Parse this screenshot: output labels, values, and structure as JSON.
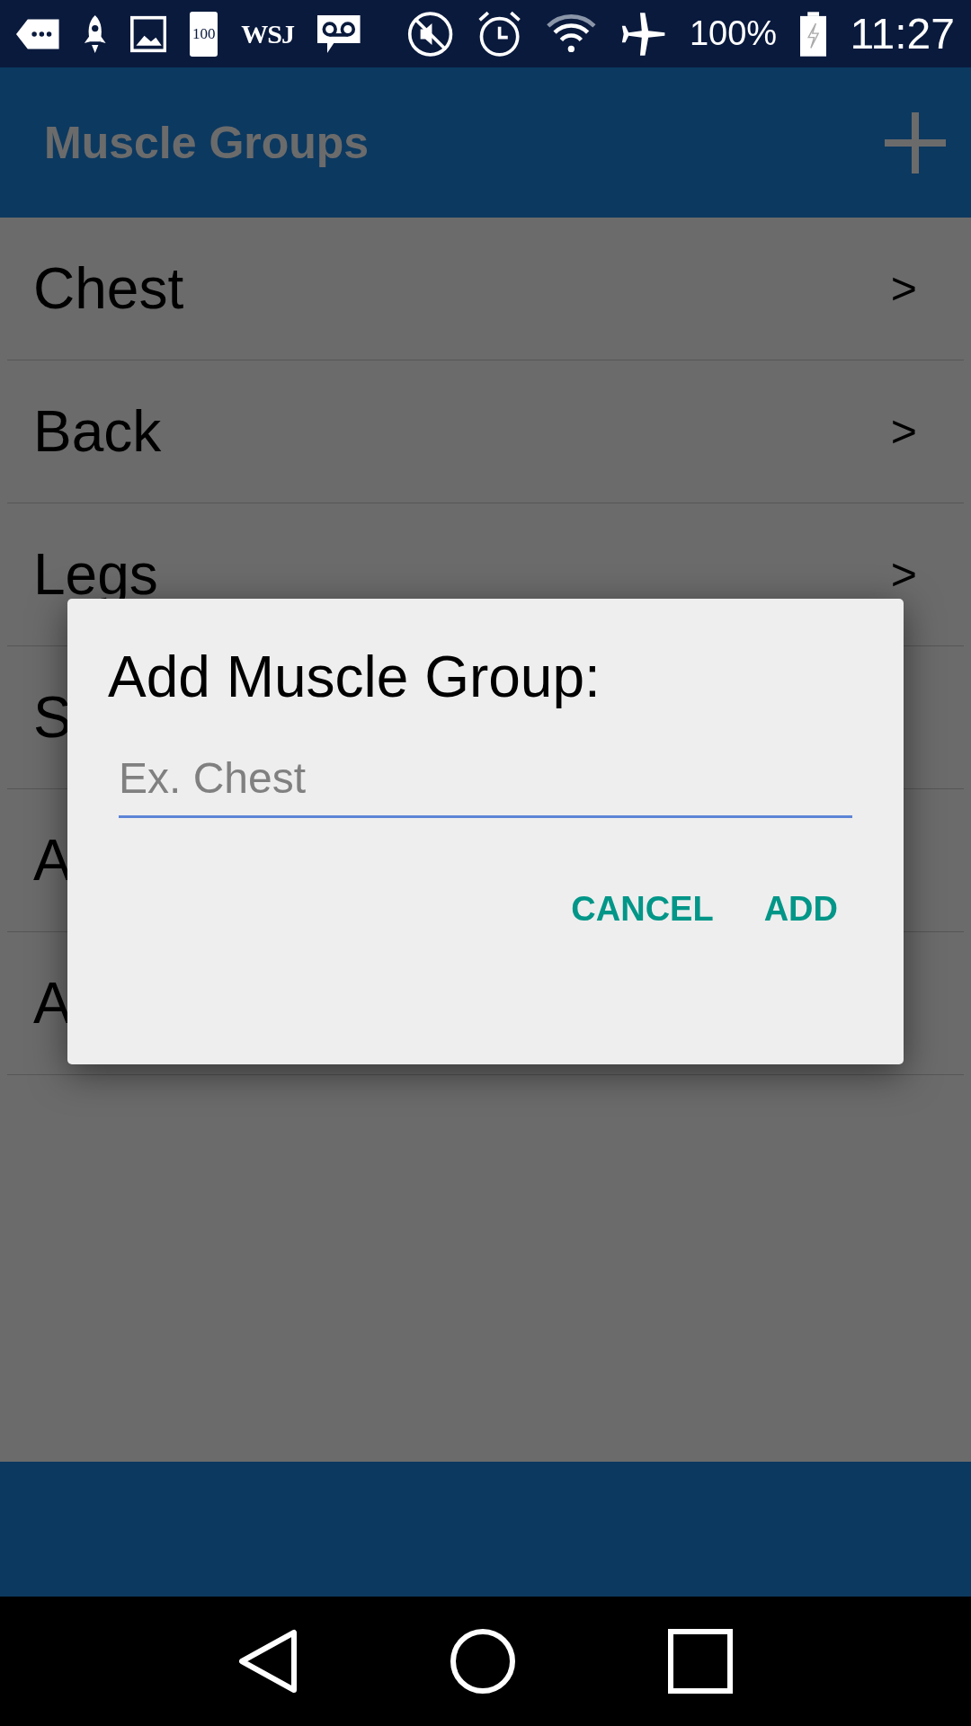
{
  "status_bar": {
    "battery_icon_text": "100",
    "news_text": "WSJ",
    "battery_percent": "100%",
    "time": "11:27"
  },
  "app_bar": {
    "title": "Muscle Groups"
  },
  "list": [
    {
      "label": "Chest",
      "chevron": ">"
    },
    {
      "label": "Back",
      "chevron": ">"
    },
    {
      "label": "Legs",
      "chevron": ">"
    },
    {
      "label": "S"
    },
    {
      "label": "A"
    },
    {
      "label": "A"
    }
  ],
  "dialog": {
    "title": "Add Muscle Group:",
    "field": {
      "placeholder": "Ex. Chest"
    },
    "buttons": [
      "CANCEL",
      "ADD"
    ]
  }
}
